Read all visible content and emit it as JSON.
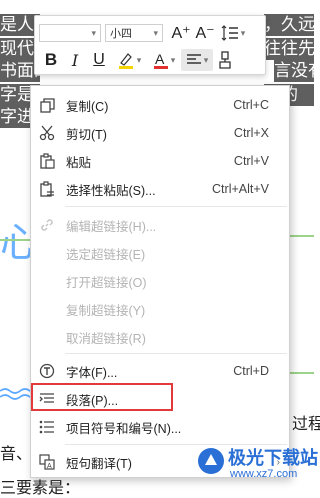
{
  "document": {
    "selected_lines": [
      "是人类",
      "现代文",
      "书面的",
      "字是由",
      "字进位"
    ],
    "selected_right_fragments": [
      "，久远",
      "往往先",
      "言没有文",
      "成的",
      ""
    ],
    "right_fragment_process": "过程",
    "left_bottom_text_1": "音、",
    "left_bottom_text_2": "三要素是："
  },
  "toolbar": {
    "font_name": "",
    "font_size": "小四",
    "grow_font_label": "A⁺",
    "shrink_font_label": "A⁻",
    "line_spacing_icon": "line-spacing-icon",
    "bold_label": "B",
    "italic_label": "I",
    "underline_label": "U",
    "highlight_color": "#f5d400",
    "font_color": "#e03030",
    "align_icon": "align-left-icon",
    "format_painter_icon": "format-painter-icon"
  },
  "menu": {
    "items": [
      {
        "label": "复制(C)",
        "shortcut": "Ctrl+C",
        "icon": "copy-icon",
        "enabled": true
      },
      {
        "label": "剪切(T)",
        "shortcut": "Ctrl+X",
        "icon": "scissors-icon",
        "enabled": true
      },
      {
        "label": "粘贴",
        "shortcut": "Ctrl+V",
        "icon": "paste-icon",
        "enabled": true
      },
      {
        "label": "选择性粘贴(S)...",
        "shortcut": "Ctrl+Alt+V",
        "icon": "paste-special-icon",
        "enabled": true
      },
      {
        "label": "编辑超链接(H)...",
        "shortcut": "",
        "icon": "link-icon",
        "enabled": false
      },
      {
        "label": "选定超链接(E)",
        "shortcut": "",
        "icon": "",
        "enabled": false
      },
      {
        "label": "打开超链接(O)",
        "shortcut": "",
        "icon": "",
        "enabled": false
      },
      {
        "label": "复制超链接(Y)",
        "shortcut": "",
        "icon": "",
        "enabled": false
      },
      {
        "label": "取消超链接(R)",
        "shortcut": "",
        "icon": "",
        "enabled": false
      },
      {
        "label": "字体(F)...",
        "shortcut": "Ctrl+D",
        "icon": "font-icon",
        "enabled": true
      },
      {
        "label": "段落(P)...",
        "shortcut": "",
        "icon": "paragraph-icon",
        "enabled": true,
        "highlighted": true
      },
      {
        "label": "项目符号和编号(N)...",
        "shortcut": "",
        "icon": "bullet-list-icon",
        "enabled": true
      },
      {
        "label": "短句翻译(T)",
        "shortcut": "",
        "icon": "translate-icon",
        "enabled": true,
        "submenu": true
      }
    ]
  },
  "watermark": {
    "title": "极光下载站",
    "url": "www.xz7.com"
  }
}
